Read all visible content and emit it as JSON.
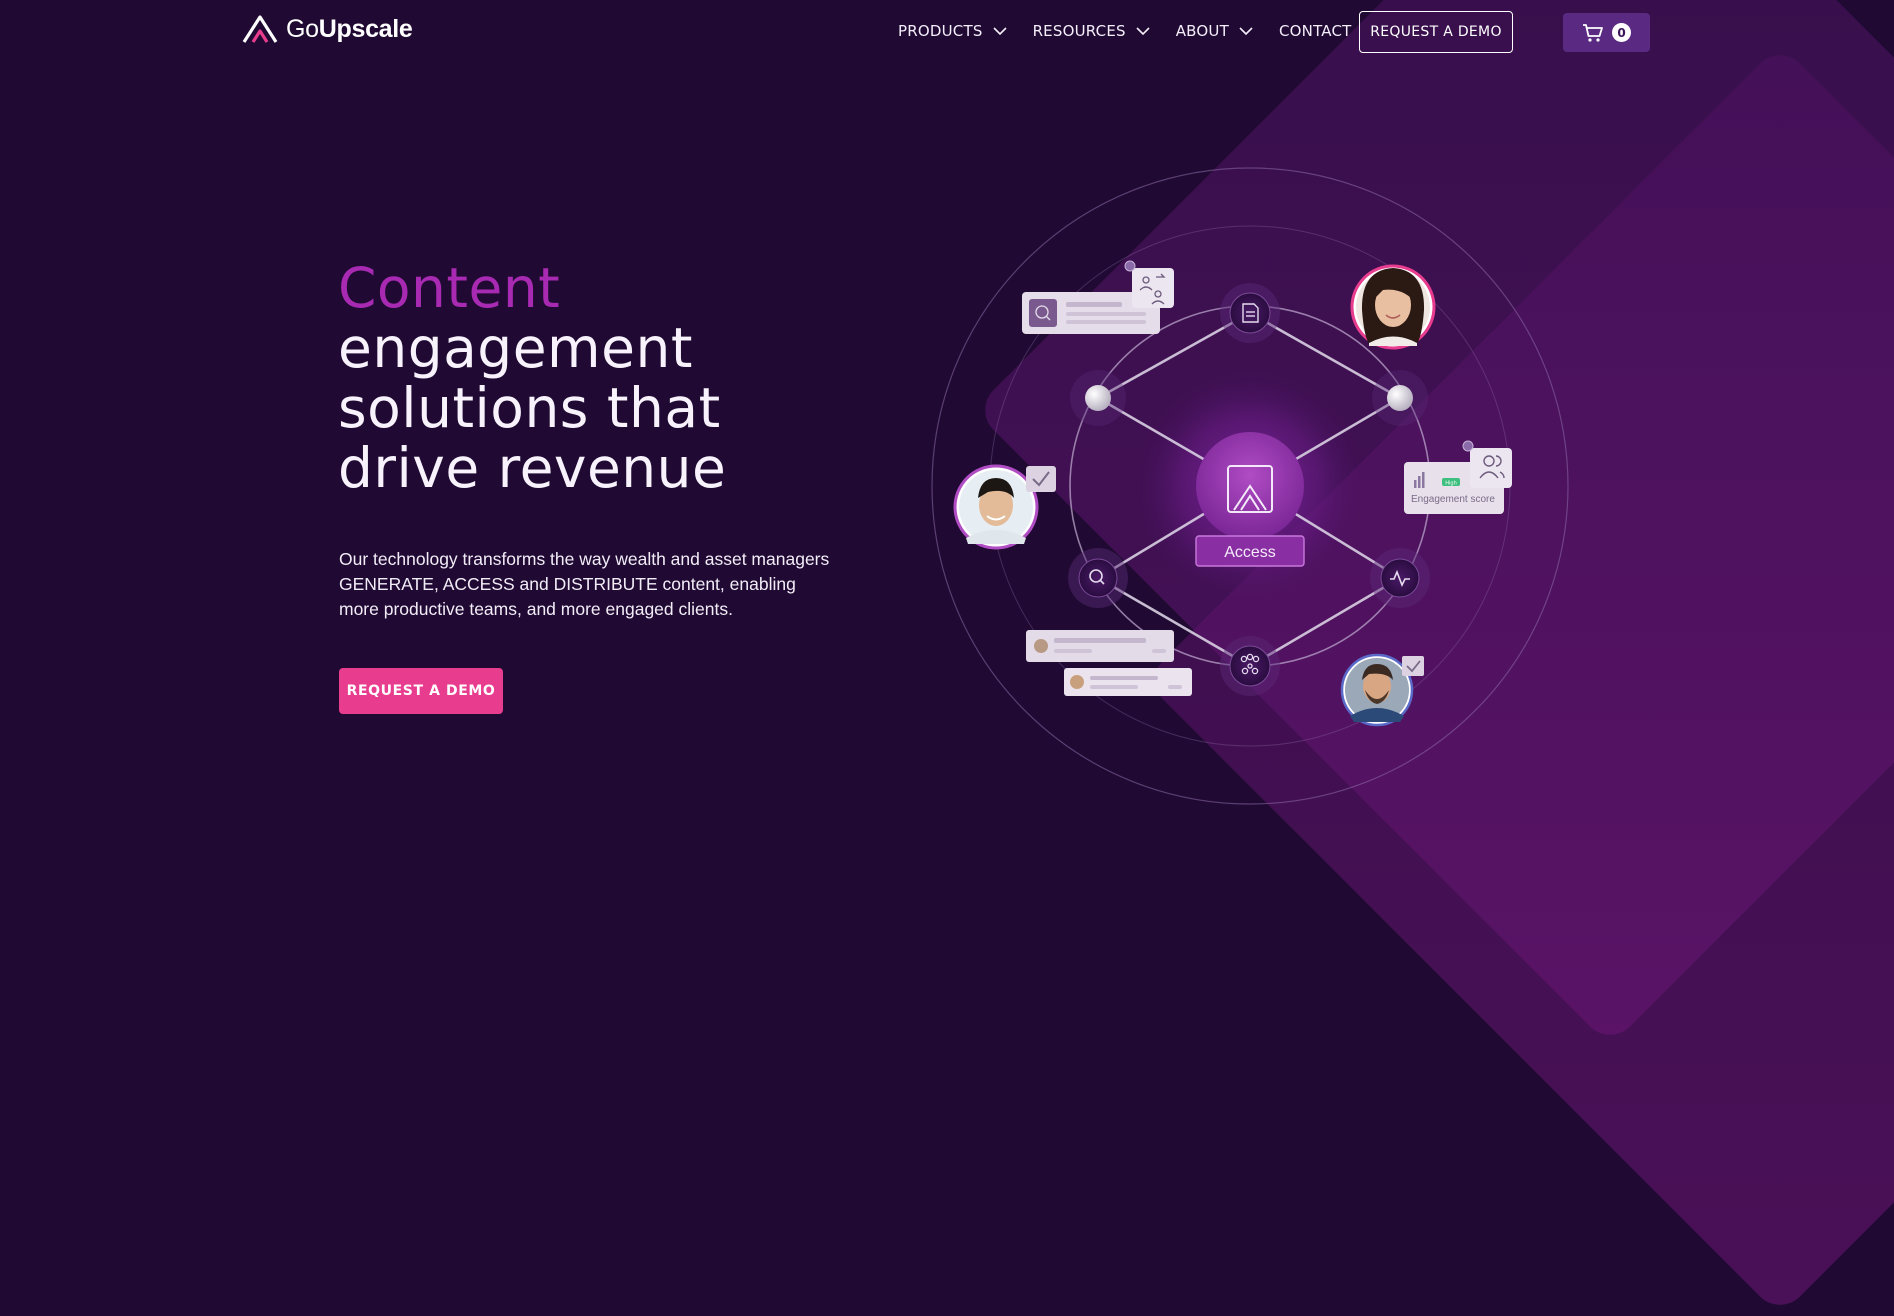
{
  "brand": {
    "name_light": "Go",
    "name_bold": "Upscale",
    "logo_icon": "upscale-chevron-logo"
  },
  "nav": {
    "items": [
      {
        "label": "PRODUCTS",
        "has_dropdown": true
      },
      {
        "label": "RESOURCES",
        "has_dropdown": true
      },
      {
        "label": "ABOUT",
        "has_dropdown": true
      },
      {
        "label": "CONTACT",
        "has_dropdown": false
      }
    ],
    "cta_label": "REQUEST A DEMO",
    "cart_icon": "cart-icon",
    "cart_count": "0"
  },
  "hero": {
    "title_accent": "Content",
    "title_rest": "engagement solutions that drive revenue",
    "description": "Our technology transforms the way wealth and asset managers GENERATE, ACCESS and DISTRIBUTE content, enabling more productive teams, and more engaged clients.",
    "cta_label": "REQUEST A DEMO"
  },
  "illustration": {
    "center_label": "Access",
    "card_label": "Engagement score",
    "badge_label": "High"
  },
  "colors": {
    "background": "#200a33",
    "accent_purple": "#a92ab2",
    "cta_pink": "#e83c8e",
    "cart_bg": "#5a2a82"
  }
}
